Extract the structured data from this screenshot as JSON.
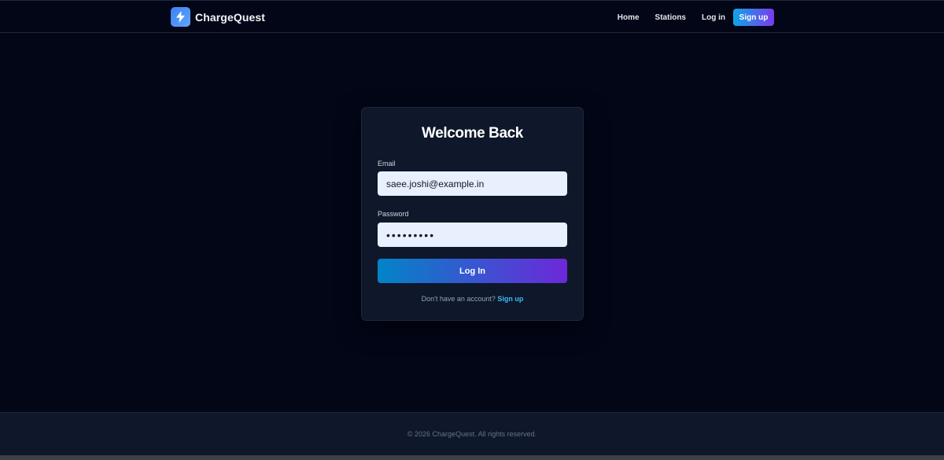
{
  "header": {
    "brand_name": "ChargeQuest",
    "logo_icon": "lightning-bolt-icon",
    "nav": {
      "home": "Home",
      "stations": "Stations",
      "login": "Log in",
      "signup": "Sign up"
    }
  },
  "login_card": {
    "title": "Welcome Back",
    "email_label": "Email",
    "email_value": "saee.joshi@example.in",
    "password_label": "Password",
    "password_value": "•••••••••",
    "submit_label": "Log In",
    "signup_prompt": "Don't have an account?",
    "signup_link": "Sign up"
  },
  "footer": {
    "copyright": "© 2026 ChargeQuest. All rights reserved."
  },
  "colors": {
    "background": "#020617",
    "card": "#0f172a",
    "accent_start": "#0284c7",
    "accent_end": "#6d28d9",
    "link": "#38bdf8"
  }
}
